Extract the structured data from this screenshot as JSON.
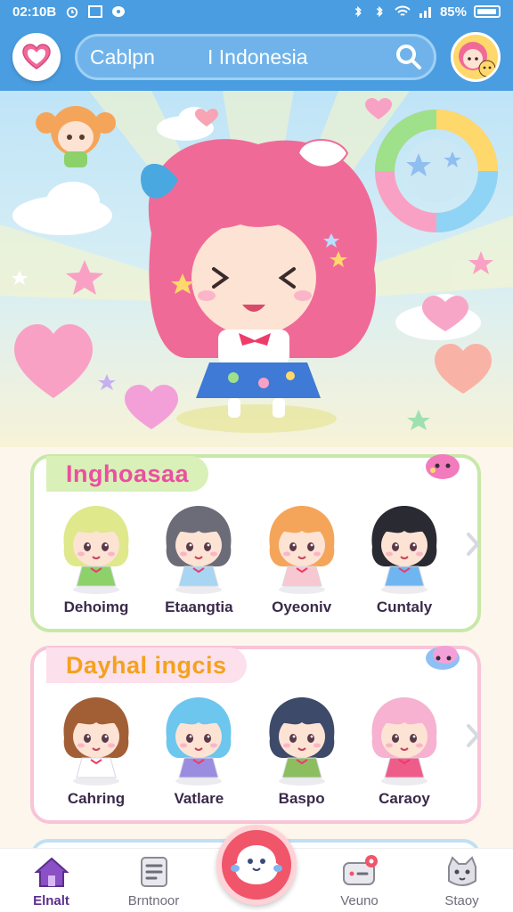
{
  "status_bar": {
    "time": "02:10B",
    "battery": "85%"
  },
  "header": {
    "search_left": "Cablpn",
    "search_right": "I Indonesia"
  },
  "sections": [
    {
      "title": "Inghoasaa",
      "characters": [
        {
          "name": "Dehoimg",
          "hair": "#dfe88a",
          "outfit": "#8cd16a"
        },
        {
          "name": "Etaangtia",
          "hair": "#6c6c78",
          "outfit": "#a7d5f2"
        },
        {
          "name": "Oyeoniv",
          "hair": "#f5a55a",
          "outfit": "#f7c8d2"
        },
        {
          "name": "Cuntaly",
          "hair": "#2a2a33",
          "outfit": "#6fb6f0"
        }
      ]
    },
    {
      "title": "Dayhal ingcis",
      "characters": [
        {
          "name": "Cahring",
          "hair": "#a25f35",
          "outfit": "#ffffff"
        },
        {
          "name": "Vatlare",
          "hair": "#6cc6ee",
          "outfit": "#9a8de0"
        },
        {
          "name": "Baspo",
          "hair": "#3d4a6a",
          "outfit": "#8cbe60"
        },
        {
          "name": "Caraoy",
          "hair": "#f6b2d0",
          "outfit": "#ee5c8a"
        }
      ]
    }
  ],
  "bottom_nav": {
    "items": [
      {
        "label": "Elnalt"
      },
      {
        "label": "Brntnoor"
      },
      {
        "label": "Veuno"
      },
      {
        "label": "Staoy"
      }
    ]
  },
  "colors": {
    "header": "#4a9de0",
    "accent_pink": "#f0556a",
    "hero_hair": "#f06a98"
  }
}
